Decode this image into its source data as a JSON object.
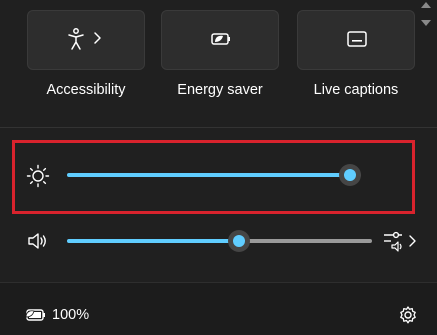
{
  "quick_settings": {
    "tiles": [
      {
        "id": "accessibility",
        "label": "Accessibility",
        "icon": "accessibility-icon",
        "has_chevron": true
      },
      {
        "id": "energy_saver",
        "label": "Energy saver",
        "icon": "energy-saver-icon"
      },
      {
        "id": "live_captions",
        "label": "Live captions",
        "icon": "live-captions-icon"
      }
    ],
    "brightness": {
      "icon": "brightness-icon",
      "value_percent": 100
    },
    "volume": {
      "icon": "speaker-icon",
      "value_percent": 57,
      "manage_audio_icon": "audio-output-icon"
    },
    "battery": {
      "icon": "battery-icon",
      "percent_text": "100%"
    },
    "settings_icon": "gear-icon"
  },
  "colors": {
    "accent": "#60cdff",
    "background": "#202020",
    "tile_background": "#2d2d2d",
    "highlight_border": "#d9232d",
    "track_unfilled": "#9a9a9a"
  }
}
